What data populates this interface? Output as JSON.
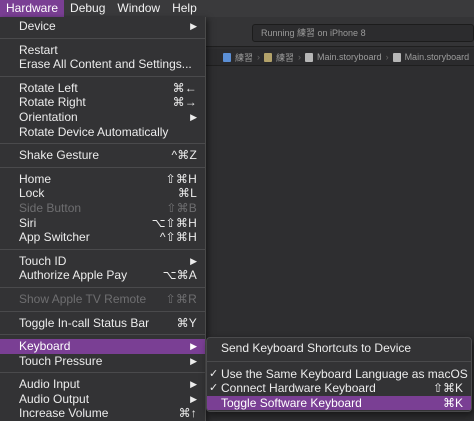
{
  "menubar": {
    "items": [
      {
        "label": "Hardware",
        "active": true
      },
      {
        "label": "Debug"
      },
      {
        "label": "Window"
      },
      {
        "label": "Help"
      }
    ]
  },
  "xcode": {
    "status_text": "Running 練習 on iPhone 8",
    "jumpbar": [
      "練習",
      "練習",
      "Main.storyboard",
      "Main.storyboard"
    ]
  },
  "menu": {
    "device": {
      "label": "Device"
    },
    "restart": {
      "label": "Restart"
    },
    "erase": {
      "label": "Erase All Content and Settings..."
    },
    "rotate_left": {
      "label": "Rotate Left",
      "shortcut": "⌘←"
    },
    "rotate_right": {
      "label": "Rotate Right",
      "shortcut": "⌘→"
    },
    "orientation": {
      "label": "Orientation"
    },
    "rotate_auto": {
      "label": "Rotate Device Automatically"
    },
    "shake": {
      "label": "Shake Gesture",
      "shortcut": "^⌘Z"
    },
    "home": {
      "label": "Home",
      "shortcut": "⇧⌘H"
    },
    "lock": {
      "label": "Lock",
      "shortcut": "⌘L"
    },
    "side_button": {
      "label": "Side Button",
      "shortcut": "⇧⌘B"
    },
    "siri": {
      "label": "Siri",
      "shortcut": "⌥⇧⌘H"
    },
    "app_switcher": {
      "label": "App Switcher",
      "shortcut": "^⇧⌘H"
    },
    "touch_id": {
      "label": "Touch ID"
    },
    "apple_pay": {
      "label": "Authorize Apple Pay",
      "shortcut": "⌥⌘A"
    },
    "apple_tv": {
      "label": "Show Apple TV Remote",
      "shortcut": "⇧⌘R"
    },
    "status_bar": {
      "label": "Toggle In-call Status Bar",
      "shortcut": "⌘Y"
    },
    "keyboard": {
      "label": "Keyboard"
    },
    "touch_pressure": {
      "label": "Touch Pressure"
    },
    "audio_input": {
      "label": "Audio Input"
    },
    "audio_output": {
      "label": "Audio Output"
    },
    "increase_volume": {
      "label": "Increase Volume",
      "shortcut": "⌘↑"
    }
  },
  "submenu": {
    "send_shortcuts": {
      "label": "Send Keyboard Shortcuts to Device"
    },
    "same_language": {
      "label": "Use the Same Keyboard Language as macOS",
      "checked": true
    },
    "connect_hw": {
      "label": "Connect Hardware Keyboard",
      "shortcut": "⇧⌘K",
      "checked": true
    },
    "toggle_sw": {
      "label": "Toggle Software Keyboard",
      "shortcut": "⌘K"
    }
  },
  "colors": {
    "highlight": "#7a3f94",
    "menu_bg": "#333335",
    "disabled": "#6e6e70"
  }
}
